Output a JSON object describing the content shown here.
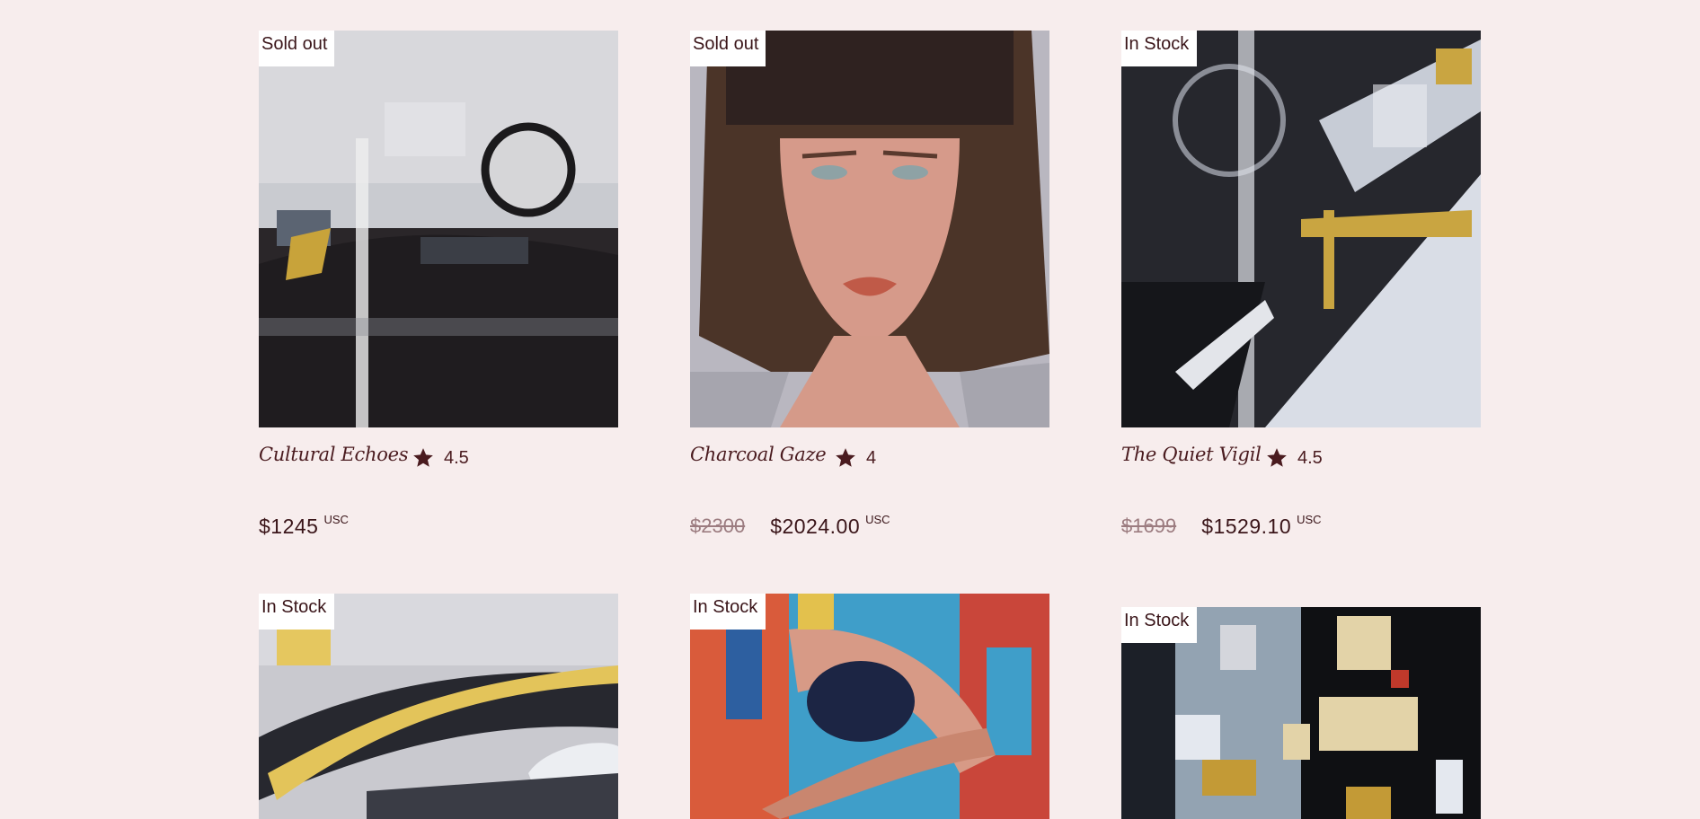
{
  "products": [
    {
      "title": "Cultural Echoes",
      "badge": "Sold out",
      "rating": "4.5",
      "old_price": "",
      "price": "$1245",
      "currency": "USC"
    },
    {
      "title": "Charcoal Gaze",
      "badge": "Sold out",
      "rating": "4",
      "old_price": "$2300",
      "price": "$2024.00",
      "currency": "USC"
    },
    {
      "title": "The Quiet Vigil",
      "badge": "In Stock",
      "rating": "4.5",
      "old_price": "$1699",
      "price": "$1529.10",
      "currency": "USC"
    },
    {
      "badge": "In Stock"
    },
    {
      "badge": "In Stock"
    },
    {
      "badge": "In Stock"
    }
  ],
  "icons": {
    "rating": "star-icon"
  },
  "colors": {
    "background": "#f7eded",
    "text": "#4a1b1f",
    "badge_bg": "#ffffff"
  }
}
